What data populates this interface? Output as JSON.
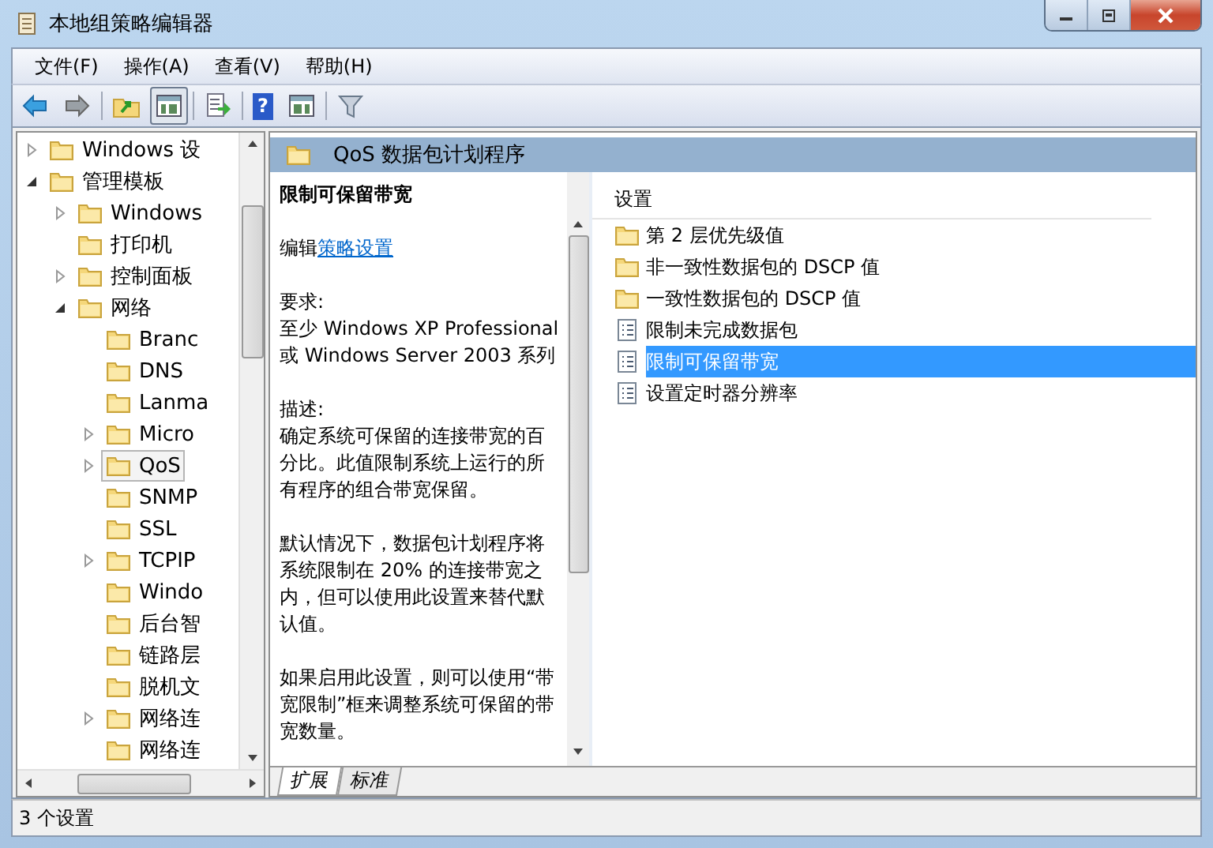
{
  "window": {
    "title": "本地组策略编辑器"
  },
  "menu": [
    "文件(F)",
    "操作(A)",
    "查看(V)",
    "帮助(H)"
  ],
  "toolbar": {
    "help_glyph": "?"
  },
  "tree": [
    {
      "label": "Windows 设",
      "expanded": false,
      "selected": false
    },
    {
      "label": "管理模板",
      "expanded": true,
      "selected": false,
      "children": [
        {
          "label": "Windows",
          "expanded": false,
          "selected": false
        },
        {
          "label": "打印机",
          "selected": false
        },
        {
          "label": "控制面板",
          "expanded": false,
          "selected": false
        },
        {
          "label": "网络",
          "expanded": true,
          "selected": false,
          "children": [
            {
              "label": "Branc",
              "selected": false
            },
            {
              "label": "DNS",
              "selected": false
            },
            {
              "label": "Lanma",
              "selected": false
            },
            {
              "label": "Micro",
              "expanded": false,
              "selected": false
            },
            {
              "label": "QoS",
              "expanded": false,
              "selected": true
            },
            {
              "label": "SNMP",
              "selected": false
            },
            {
              "label": "SSL",
              "selected": false
            },
            {
              "label": "TCPIP",
              "expanded": false,
              "selected": false
            },
            {
              "label": "Windo",
              "selected": false
            },
            {
              "label": "后台智",
              "selected": false
            },
            {
              "label": "链路层",
              "selected": false
            },
            {
              "label": "脱机文",
              "selected": false
            },
            {
              "label": "网络连",
              "expanded": false,
              "selected": false
            },
            {
              "label": "网络连",
              "selected": false
            }
          ]
        }
      ]
    }
  ],
  "header": {
    "title": "QoS 数据包计划程序"
  },
  "detail": {
    "title": "限制可保留带宽",
    "edit_prefix": "编辑",
    "edit_link": "策略设置",
    "requirements_label": "要求:",
    "requirements": "至少 Windows XP Professional 或 Windows Server 2003 系列",
    "description_label": "描述:",
    "paragraphs": [
      "确定系统可保留的连接带宽的百分比。此值限制系统上运行的所有程序的组合带宽保留。",
      "默认情况下，数据包计划程序将系统限制在 20% 的连接带宽之内，但可以使用此设置来替代默认值。",
      "如果启用此设置，则可以使用“带宽限制”框来调整系统可保留的带宽数量。"
    ]
  },
  "list": {
    "column": "设置",
    "items": [
      {
        "label": "第 2 层优先级值",
        "kind": "folder",
        "selected": false
      },
      {
        "label": "非一致性数据包的 DSCP 值",
        "kind": "folder",
        "selected": false
      },
      {
        "label": "一致性数据包的 DSCP 值",
        "kind": "folder",
        "selected": false
      },
      {
        "label": "限制未完成数据包",
        "kind": "policy",
        "selected": false
      },
      {
        "label": "限制可保留带宽",
        "kind": "policy",
        "selected": true
      },
      {
        "label": "设置定时器分辨率",
        "kind": "policy",
        "selected": false
      }
    ]
  },
  "tabs": [
    {
      "label": "扩展",
      "selected": true
    },
    {
      "label": "标准",
      "selected": false
    }
  ],
  "status_bar": "3 个设置"
}
